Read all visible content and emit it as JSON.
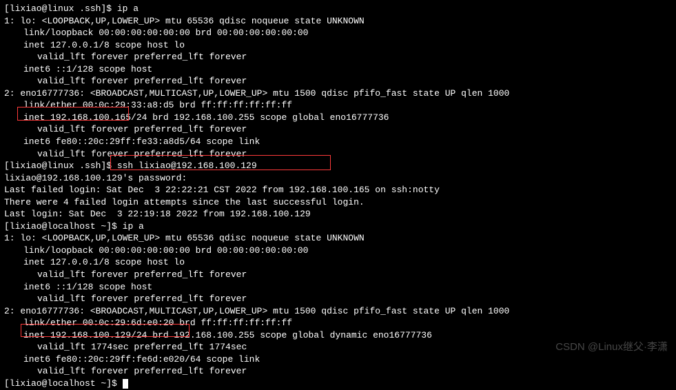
{
  "prompt1": "[lixiao@linux .ssh]$ ",
  "cmd1": "ip a",
  "lo_header": "1: lo: <LOOPBACK,UP,LOWER_UP> mtu 65536 qdisc noqueue state UNKNOWN",
  "lo_link": "link/loopback 00:00:00:00:00:00 brd 00:00:00:00:00:00",
  "lo_inet": "inet 127.0.0.1/8 scope host lo",
  "valid_forever": "valid_lft forever preferred_lft forever",
  "lo_inet6": "inet6 ::1/128 scope host",
  "eno_header": "2: eno16777736: <BROADCAST,MULTICAST,UP,LOWER_UP> mtu 1500 qdisc pfifo_fast state UP qlen 1000",
  "eno_link1": "link/ether 00:0c:29:33:a8:d5 brd ff:ff:ff:ff:ff:ff",
  "eno_inet1": "inet 192.168.100.165/24 brd 192.168.100.255 scope global eno16777736",
  "eno_inet6_1": "inet6 fe80::20c:29ff:fe33:a8d5/64 scope link",
  "prompt2": "[lixiao@linux .ssh]$ ",
  "cmd2": "ssh lixiao@192.168.100.129",
  "pw_prompt": "lixiao@192.168.100.129's password:",
  "last_failed": "Last failed login: Sat Dec  3 22:22:21 CST 2022 from 192.168.100.165 on ssh:notty",
  "failed_attempts": "There were 4 failed login attempts since the last successful login.",
  "last_login": "Last login: Sat Dec  3 22:19:18 2022 from 192.168.100.129",
  "prompt3": "[lixiao@localhost ~]$ ",
  "cmd3": "ip a",
  "eno_link2": "link/ether 00:0c:29:6d:e0:20 brd ff:ff:ff:ff:ff:ff",
  "eno_inet2": "inet 192.168.100.129/24 brd 192.168.100.255 scope global dynamic eno16777736",
  "valid_1774": "valid_lft 1774sec preferred_lft 1774sec",
  "eno_inet6_2": "inet6 fe80::20c:29ff:fe6d:e020/64 scope link",
  "prompt4": "[lixiao@localhost ~]$ ",
  "watermark": "CSDN @Linux继父·李潇"
}
